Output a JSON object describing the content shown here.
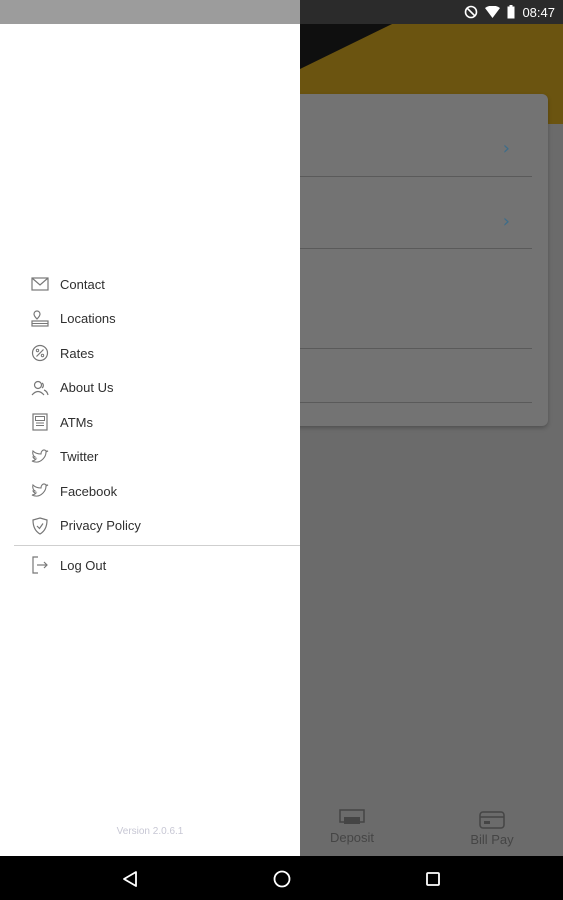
{
  "status_bar": {
    "time": "08:47",
    "icons": [
      "do-not-disturb-icon",
      "wifi-icon",
      "battery-icon"
    ]
  },
  "drawer": {
    "menu_items": [
      {
        "label": "Contact",
        "icon": "envelope-icon"
      },
      {
        "label": "Locations",
        "icon": "location-pin-icon"
      },
      {
        "label": "Rates",
        "icon": "percent-icon"
      },
      {
        "label": "About Us",
        "icon": "people-icon"
      },
      {
        "label": "ATMs",
        "icon": "atm-icon"
      },
      {
        "label": "Twitter",
        "icon": "twitter-bird-icon"
      },
      {
        "label": "Facebook",
        "icon": "facebook-icon"
      },
      {
        "label": "Privacy Policy",
        "icon": "shield-icon"
      }
    ],
    "logout": {
      "label": "Log Out",
      "icon": "logout-icon"
    },
    "version": "Version 2.0.6.1"
  },
  "background_app": {
    "bottom_tabs": [
      {
        "label": "Deposit",
        "icon": "deposit-icon"
      },
      {
        "label": "Bill Pay",
        "icon": "bill-pay-icon"
      }
    ]
  },
  "nav_bar": {
    "buttons": [
      "back-icon",
      "home-icon",
      "recents-icon"
    ]
  },
  "colors": {
    "accent_gold": "#c9a227",
    "scrim": "#6e6e6e",
    "drawer_bg": "#ffffff",
    "chevron": "#3d6d8a"
  }
}
